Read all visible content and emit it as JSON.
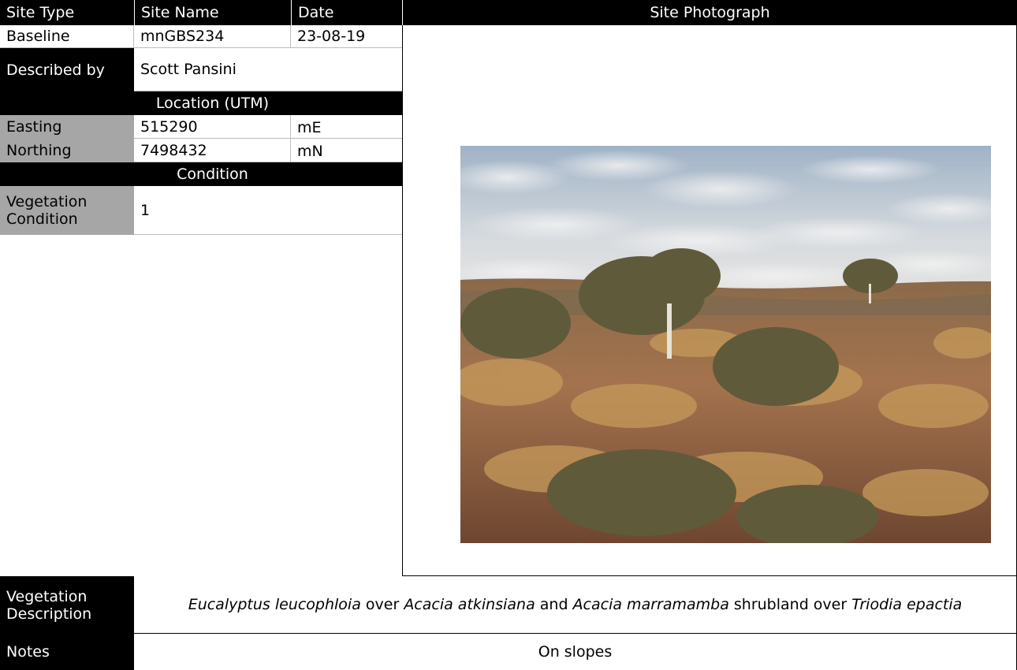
{
  "header": {
    "site_type": "Site Type",
    "site_name": "Site Name",
    "date": "Date",
    "site_photograph": "Site Photograph"
  },
  "row1": {
    "site_type": "Baseline",
    "site_name": "mnGBS234",
    "date": "23-08-19"
  },
  "described_by": {
    "label": "Described by",
    "value": "Scott Pansini"
  },
  "location": {
    "title": "Location (UTM)",
    "easting": {
      "label": "Easting",
      "value": "515290",
      "unit": "mE"
    },
    "northing": {
      "label": "Northing",
      "value": "7498432",
      "unit": "mN"
    }
  },
  "condition": {
    "title": "Condition",
    "vegetation_condition": {
      "label": "Vegetation Condition",
      "value": "1"
    }
  },
  "vegetation_description": {
    "label": "Vegetation Description",
    "parts": [
      "Eucalyptus leucophloia",
      " over ",
      "Acacia atkinsiana",
      " and ",
      "Acacia marramamba",
      " shrubland over ",
      "Triodia epactia"
    ]
  },
  "notes": {
    "label": "Notes",
    "value": "On slopes"
  }
}
